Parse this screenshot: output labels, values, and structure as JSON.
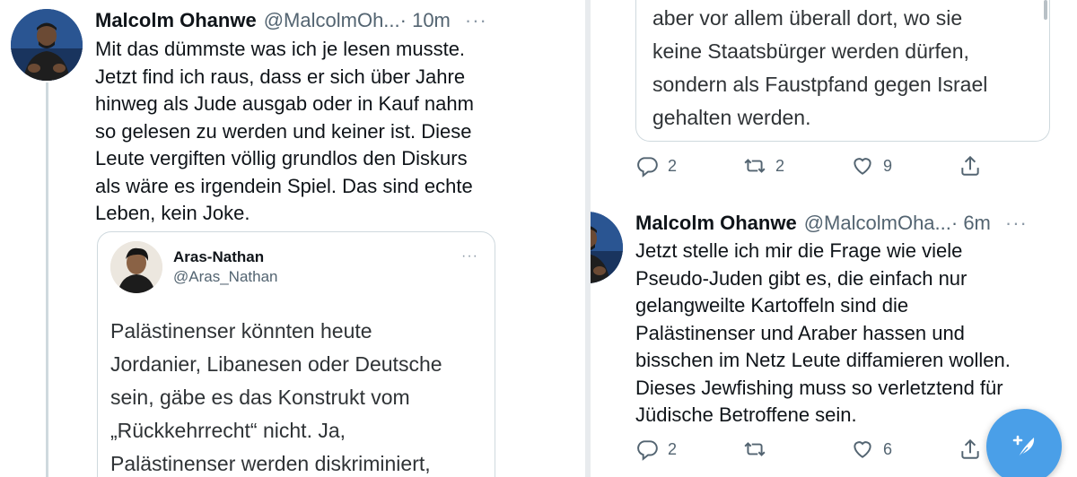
{
  "left_tweet": {
    "author_name": "Malcolm Ohanwe",
    "handle": "@MalcolmOh...",
    "time": "· 10m",
    "more": "···",
    "text_lines": [
      "Mit das dümmste was ich je lesen musste.",
      "Jetzt find ich raus, dass er sich über Jahre",
      "hinweg als Jude ausgab oder in Kauf nahm",
      "so gelesen zu werden und keiner ist. Diese",
      "Leute vergiften völlig grundlos den Diskurs",
      "als wäre es irgendein Spiel. Das sind echte",
      "Leben, kein Joke."
    ],
    "avatar_icon": "person-avatar",
    "quote": {
      "author_name": "Aras-Nathan",
      "handle": "@Aras_Nathan",
      "more": "···",
      "avatar_icon": "person-avatar",
      "text_lines": [
        "Palästinenser könnten heute",
        "Jordanier, Libanesen oder Deutsche",
        "sein, gäbe es das Konstrukt vom",
        "„Rückkehrrecht“ nicht. Ja,",
        "Palästinenser werden diskriminiert,"
      ]
    }
  },
  "right_quote_fragment": {
    "text_lines": [
      "aber vor allem überall dort, wo sie",
      "keine Staatsbürger werden dürfen,",
      "sondern als Faustpfand gegen Israel",
      "gehalten werden."
    ],
    "actions": {
      "reply_count": "2",
      "retweet_count": "2",
      "like_count": "9"
    }
  },
  "right_tweet": {
    "author_name": "Malcolm Ohanwe",
    "handle": "@MalcolmOha...",
    "time": "· 6m",
    "more": "···",
    "avatar_icon": "person-avatar",
    "text_lines": [
      "Jetzt stelle ich mir die Frage wie viele",
      "Pseudo-Juden gibt es, die einfach nur",
      "gelangweilte Kartoffeln sind die",
      "Palästinenser und Araber hassen und",
      "bisschen im Netz Leute diffamieren wollen.",
      "Dieses Jewfishing muss so verletztend für",
      "Jüdische Betroffene sein."
    ],
    "actions": {
      "reply_count": "2",
      "like_count": "6"
    }
  },
  "icons": {
    "reply": "reply-icon",
    "retweet": "retweet-icon",
    "like": "heart-icon",
    "share": "share-icon",
    "compose": "compose-feather-icon"
  },
  "colors": {
    "accent": "#4a9fe8",
    "secondary_text": "#536471",
    "border": "#cfd9de"
  }
}
